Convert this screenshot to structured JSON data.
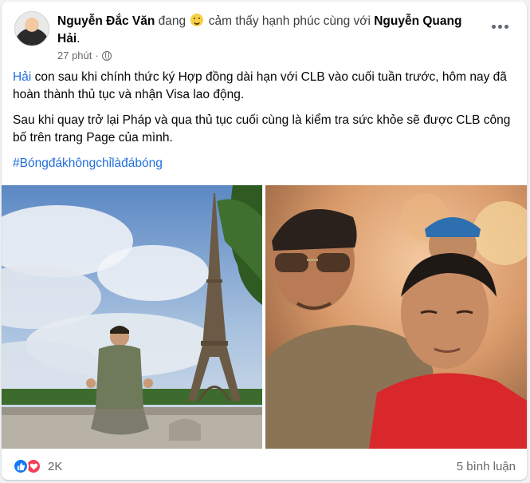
{
  "post": {
    "author": "Nguyễn Đắc Văn",
    "verb_prefix": "đang",
    "feeling": "cảm thấy hạnh phúc cùng với",
    "tagged": "Nguyễn Quang Hải",
    "period": ".",
    "time": "27 phút",
    "separator": "·",
    "text": {
      "p1_link": "Hải",
      "p1_rest": " con sau khi chính thức ký Hợp đồng dài hạn với CLB vào cuối tuần trước, hôm nay đã hoàn thành thủ tục và nhận Visa lao động.",
      "p2": "Sau khi quay trở lại Pháp và qua thủ tục cuối cùng là kiểm tra sức khỏe sẽ được CLB công bố trên trang Page của mình.",
      "hashtag": "#Bóngđákhôngchỉlàđábóng"
    }
  },
  "footer": {
    "reaction_count": "2K",
    "comments": "5 bình luận"
  },
  "colors": {
    "link": "#216fdb",
    "like": "#1877f2",
    "heart": "#f33e58"
  },
  "icons": [
    "feeling-happy-icon",
    "globe-icon",
    "more-options-icon",
    "like-icon",
    "love-icon"
  ]
}
